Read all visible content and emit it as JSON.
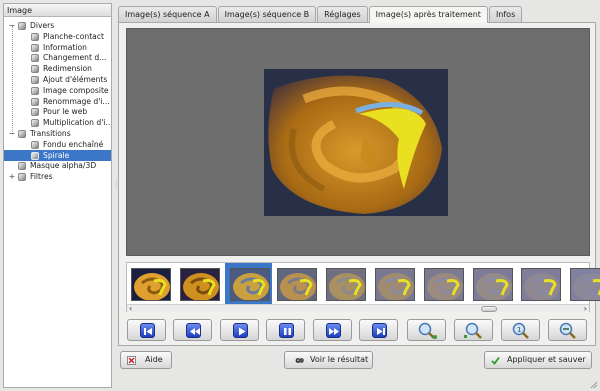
{
  "tree": {
    "header": "Image",
    "items": [
      {
        "label": "Divers",
        "level": 1,
        "expander": "−"
      },
      {
        "label": "Planche-contact",
        "level": 2
      },
      {
        "label": "Information",
        "level": 2
      },
      {
        "label": "Changement d...",
        "level": 2
      },
      {
        "label": "Redimension",
        "level": 2
      },
      {
        "label": "Ajout d'éléments",
        "level": 2
      },
      {
        "label": "Image composite",
        "level": 2
      },
      {
        "label": "Renommage d'i...",
        "level": 2
      },
      {
        "label": "Pour le web",
        "level": 2
      },
      {
        "label": "Multiplication d'i...",
        "level": 2
      },
      {
        "label": "Transitions",
        "level": 1,
        "expander": "−"
      },
      {
        "label": "Fondu enchaîné",
        "level": 2
      },
      {
        "label": "Spirale",
        "level": 2,
        "selected": true
      },
      {
        "label": "Masque alpha/3D",
        "level": 1
      },
      {
        "label": "Filtres",
        "level": 1,
        "expander": "+"
      }
    ]
  },
  "tabs": [
    {
      "label": "Image(s) séquence A",
      "active": false
    },
    {
      "label": "Image(s) séquence B",
      "active": false
    },
    {
      "label": "Réglages",
      "active": false
    },
    {
      "label": "Image(s) après traitement",
      "active": true
    },
    {
      "label": "Infos",
      "active": false
    }
  ],
  "viewer": {
    "image_icon": "spiral-transition-preview"
  },
  "thumbnails": {
    "count": 10,
    "selected_index": 2
  },
  "controls": [
    {
      "name": "first-frame-button",
      "icon": "skip-to-start-icon"
    },
    {
      "name": "previous-frame-button",
      "icon": "rewind-icon"
    },
    {
      "name": "play-button",
      "icon": "play-icon"
    },
    {
      "name": "pause-button",
      "icon": "pause-icon"
    },
    {
      "name": "next-frame-button",
      "icon": "fast-forward-icon"
    },
    {
      "name": "last-frame-button",
      "icon": "skip-to-end-icon"
    },
    {
      "name": "zoom-in-button",
      "icon": "zoom-in-icon"
    },
    {
      "name": "zoom-fit-button",
      "icon": "zoom-fit-icon"
    },
    {
      "name": "zoom-original-button",
      "icon": "zoom-original-icon"
    },
    {
      "name": "zoom-out-button",
      "icon": "zoom-out-icon"
    }
  ],
  "bottom": {
    "help_label": "Aide",
    "view_result_label": "Voir le résultat",
    "apply_save_label": "Appliquer et sauver"
  },
  "colors": {
    "selection": "#3c76c6",
    "viewer_bg": "#6e6e6e",
    "media_button": "#2a4fd0"
  }
}
